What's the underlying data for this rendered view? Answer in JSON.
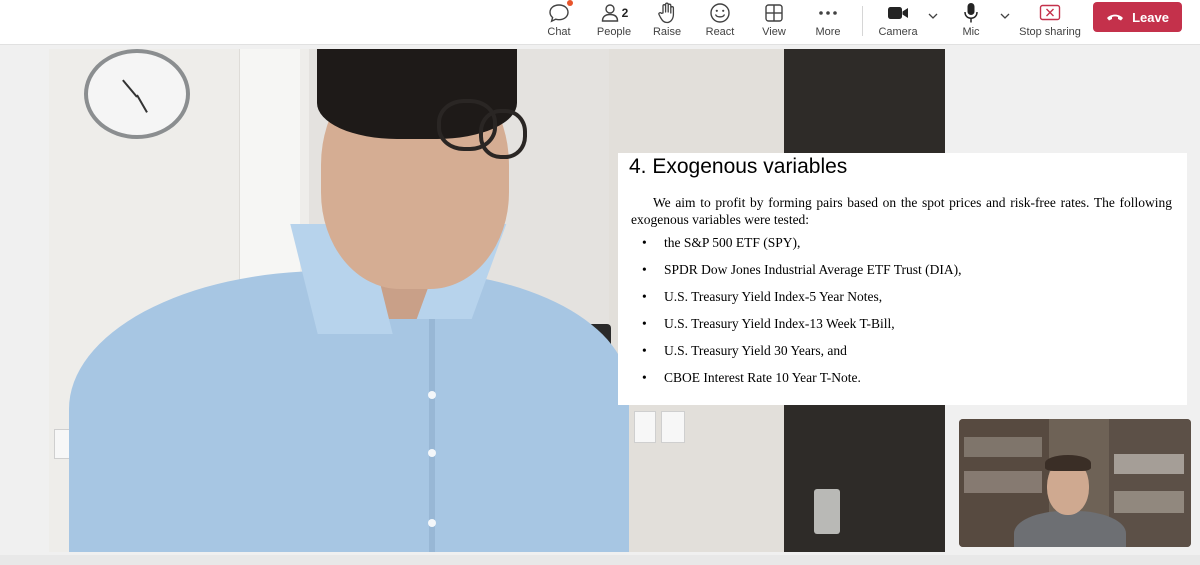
{
  "toolbar": {
    "chat_label": "Chat",
    "people_label": "People",
    "people_count": "2",
    "raise_label": "Raise",
    "react_label": "React",
    "view_label": "View",
    "more_label": "More",
    "camera_label": "Camera",
    "mic_label": "Mic",
    "stop_sharing_label": "Stop sharing",
    "leave_label": "Leave"
  },
  "colors": {
    "leave_button": "#c4314b",
    "chat_badge": "#e8542b",
    "stop_sharing_icon": "#c4314b"
  },
  "icons": [
    "chat-icon",
    "people-icon",
    "raise-hand-icon",
    "react-icon",
    "view-icon",
    "more-icon",
    "camera-icon",
    "mic-icon",
    "stop-sharing-icon",
    "phone-hangup-icon"
  ],
  "slide": {
    "title": "4. Exogenous variables",
    "intro": "We aim to profit by forming pairs based on the spot prices and risk-free rates. The following exogenous variables were tested:",
    "items": [
      "the S&P 500 ETF (SPY),",
      "SPDR Dow Jones Industrial Average ETF Trust (DIA),",
      "U.S. Treasury Yield Index-5 Year Notes,",
      "U.S. Treasury Yield Index-13 Week T-Bill,",
      "U.S. Treasury Yield 30 Years, and",
      "CBOE Interest Rate 10 Year T-Note."
    ]
  }
}
